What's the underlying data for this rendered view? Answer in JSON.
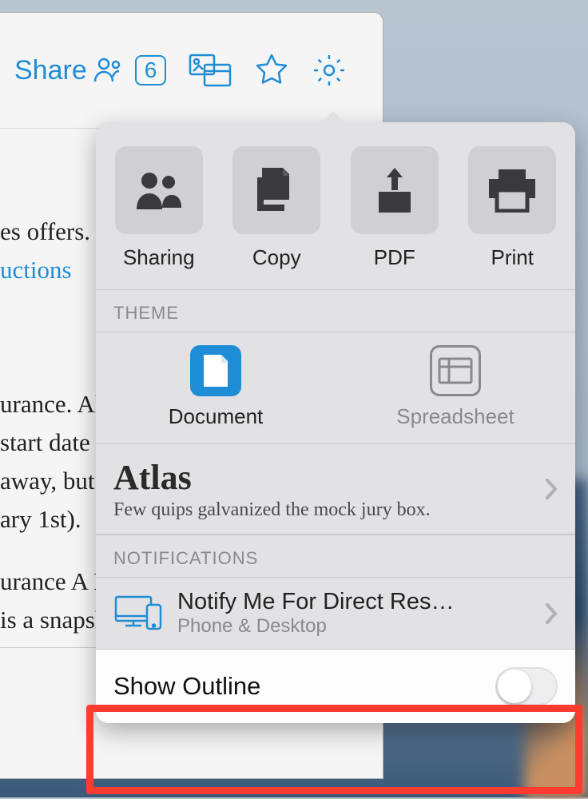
{
  "toolbar": {
    "share_label": "Share",
    "share_count": "6"
  },
  "document": {
    "line1": "es offers. E",
    "link1": "uctions",
    "line2": "urance. Al",
    "line3": " start date ",
    "line4": " away, but ",
    "line5": "ary 1st).",
    "line6": "urance A H",
    "line7": " is a snapsh"
  },
  "popover": {
    "actions": {
      "sharing": "Sharing",
      "copy": "Copy",
      "pdf": "PDF",
      "print": "Print"
    },
    "theme_header": "THEME",
    "theme": {
      "document": "Document",
      "spreadsheet": "Spreadsheet"
    },
    "font": {
      "title": "Atlas",
      "sample": "Few quips galvanized the mock jury box."
    },
    "notifications_header": "NOTIFICATIONS",
    "notify": {
      "title": "Notify Me For Direct Res…",
      "sub": "Phone & Desktop"
    },
    "outline_label": "Show Outline"
  }
}
